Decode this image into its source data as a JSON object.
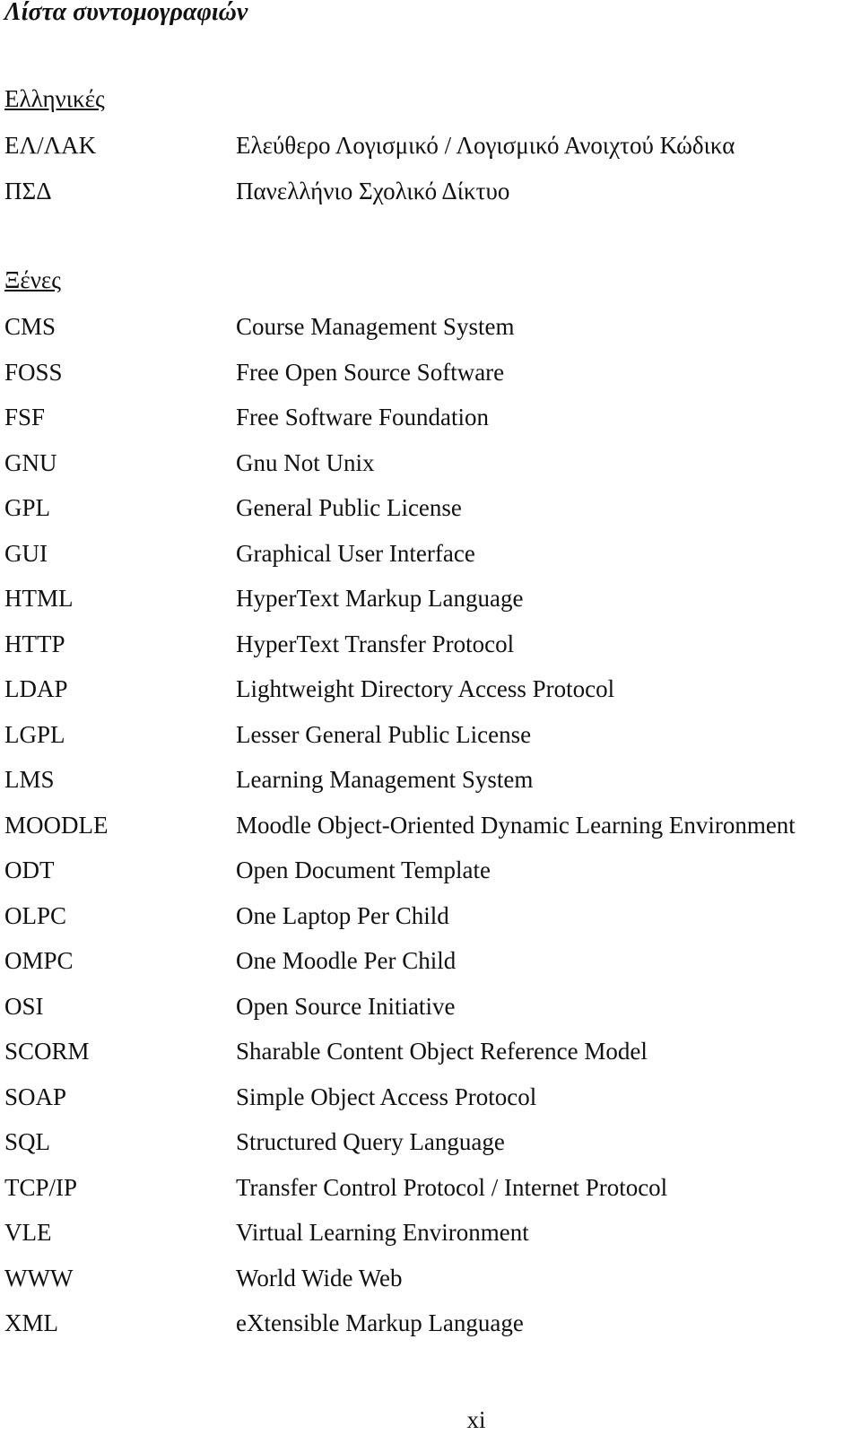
{
  "title": "Λίστα συντομογραφιών",
  "sections": [
    {
      "heading": "Ελληνικές",
      "entries": [
        {
          "abbr": "ΕΛ/ΛΑΚ",
          "full": "Ελεύθερο Λογισμικό / Λογισμικό Ανοιχτού Κώδικα"
        },
        {
          "abbr": "ΠΣΔ",
          "full": "Πανελλήνιο Σχολικό Δίκτυο"
        }
      ]
    },
    {
      "heading": "Ξένες",
      "entries": [
        {
          "abbr": "CMS",
          "full": "Course Management System"
        },
        {
          "abbr": "FOSS",
          "full": "Free Open Source Software"
        },
        {
          "abbr": "FSF",
          "full": "Free Software Foundation"
        },
        {
          "abbr": "GNU",
          "full": "Gnu Not Unix"
        },
        {
          "abbr": "GPL",
          "full": "General Public License"
        },
        {
          "abbr": "GUI",
          "full": "Graphical User Interface"
        },
        {
          "abbr": "HTML",
          "full": "HyperText Markup Language"
        },
        {
          "abbr": "HTTP",
          "full": "HyperText Transfer Protocol"
        },
        {
          "abbr": "LDAP",
          "full": "Lightweight Directory Access Protocol"
        },
        {
          "abbr": "LGPL",
          "full": "Lesser General Public License"
        },
        {
          "abbr": "LMS",
          "full": "Learning Management System"
        },
        {
          "abbr": "MOODLE",
          "full": "Moodle Object-Oriented Dynamic Learning Environment"
        },
        {
          "abbr": "ODT",
          "full": "Open Document Template"
        },
        {
          "abbr": "OLPC",
          "full": "One Laptop Per Child"
        },
        {
          "abbr": "OMPC",
          "full": "One Moodle Per Child"
        },
        {
          "abbr": "OSI",
          "full": "Open Source Initiative"
        },
        {
          "abbr": "SCORM",
          "full": "Sharable Content Object Reference Model"
        },
        {
          "abbr": "SOAP",
          "full": "Simple Object Access Protocol"
        },
        {
          "abbr": "SQL",
          "full": "Structured Query Language"
        },
        {
          "abbr": "TCP/IP",
          "full": "Transfer Control Protocol / Internet Protocol"
        },
        {
          "abbr": "VLE",
          "full": "Virtual Learning Environment"
        },
        {
          "abbr": "WWW",
          "full": "World Wide Web"
        },
        {
          "abbr": "XML",
          "full": "eXtensible Markup Language"
        }
      ]
    }
  ],
  "page_number": "xi"
}
